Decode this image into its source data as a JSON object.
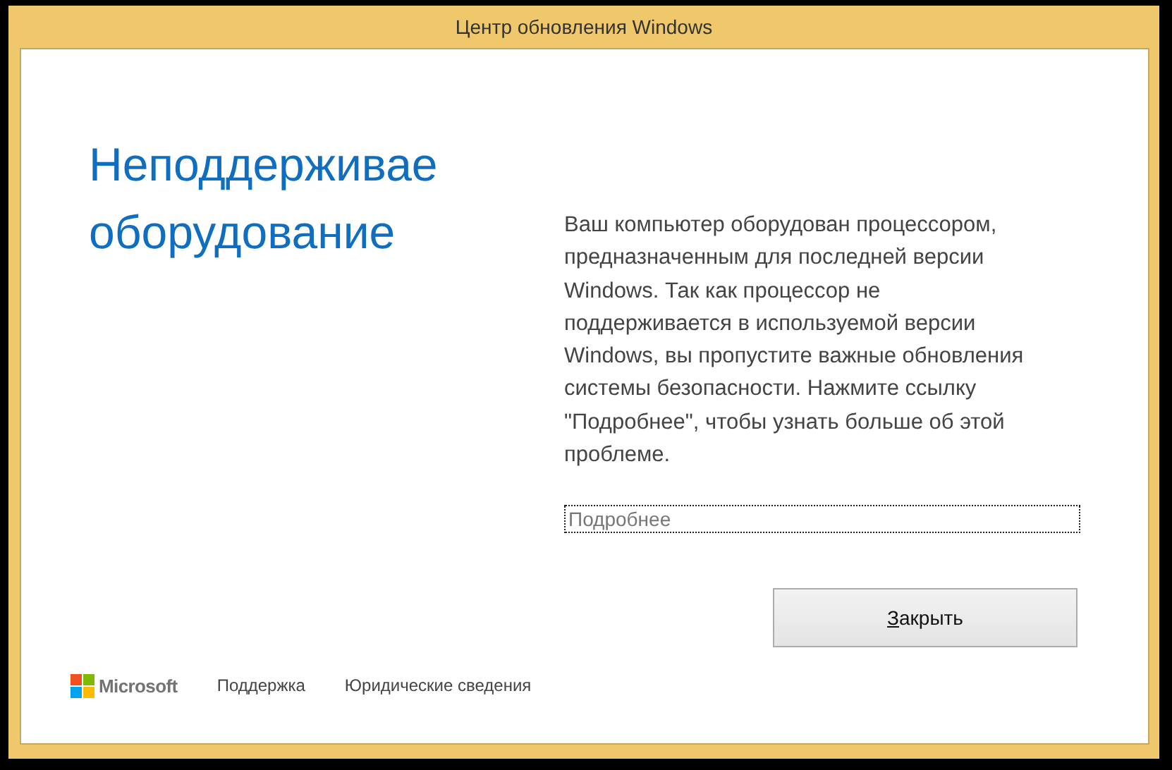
{
  "window": {
    "title": "Центр обновления Windows"
  },
  "heading_lines": [
    "Неподдерживае",
    "оборудование"
  ],
  "message_lines": [
    "Ваш компьютер оборудован процессором,",
    "предназначенным для последней версии",
    "Windows. Так как процессор не",
    "поддерживается в используемой версии",
    "Windows, вы пропустите важные обновления",
    "системы безопасности. Нажмите ссылку",
    "\"Подробнее\", чтобы узнать больше об этой",
    "проблеме."
  ],
  "link": {
    "label": "Подробнее",
    "focused": true
  },
  "button": {
    "label": "Закрыть",
    "mnemonic": true
  },
  "footer": {
    "brand": "Microsoft",
    "links": [
      "Поддержка",
      "Юридические сведения"
    ]
  }
}
